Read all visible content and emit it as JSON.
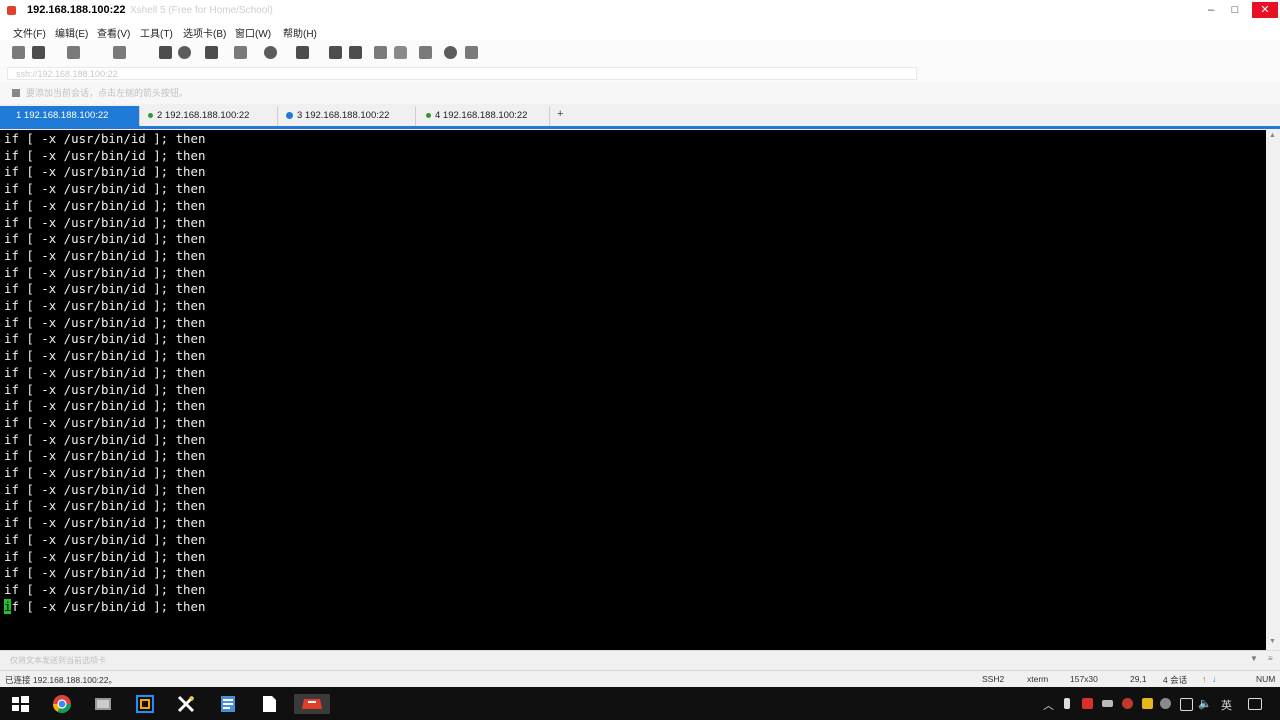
{
  "window": {
    "title": "192.168.188.100:22",
    "title_ghost": "Xshell 5 (Free for Home/School)"
  },
  "menu": [
    "文件(F)",
    "编辑(E)",
    "查看(V)",
    "工具(T)",
    "选项卡(B)",
    "窗口(W)",
    "帮助(H)"
  ],
  "toolbar": {
    "icons": [
      "new-session-icon",
      "open-folder-icon",
      "connect-icon",
      "reconnect-icon",
      "copy-icon",
      "find-icon",
      "print-icon",
      "transfer-icon",
      "globe-icon",
      "font-icon",
      "xftp-icon",
      "script-icon",
      "fullscreen-icon",
      "lock-icon",
      "keyboard-icon",
      "help-icon",
      "chat-icon"
    ]
  },
  "address": {
    "value": "ssh://192.168.188.100:22"
  },
  "sessions": {
    "label": "要添加当前会话，点击左侧的箭头按钮。"
  },
  "tabs": [
    {
      "label": "1 192.168.188.100:22",
      "active": true
    },
    {
      "label": "2 192.168.188.100:22",
      "active": false
    },
    {
      "label": "3 192.168.188.100:22",
      "active": false
    },
    {
      "label": "4 192.168.188.100:22",
      "active": false
    }
  ],
  "tab_add": "+",
  "terminal": {
    "cursor_char": "i",
    "lines": [
      "if [ -x /usr/bin/id ]; then",
      "if [ -x /usr/bin/id ]; then",
      "if [ -x /usr/bin/id ]; then",
      "if [ -x /usr/bin/id ]; then",
      "if [ -x /usr/bin/id ]; then",
      "if [ -x /usr/bin/id ]; then",
      "if [ -x /usr/bin/id ]; then",
      "if [ -x /usr/bin/id ]; then",
      "if [ -x /usr/bin/id ]; then",
      "if [ -x /usr/bin/id ]; then",
      "if [ -x /usr/bin/id ]; then",
      "if [ -x /usr/bin/id ]; then",
      "if [ -x /usr/bin/id ]; then",
      "if [ -x /usr/bin/id ]; then",
      "if [ -x /usr/bin/id ]; then",
      "if [ -x /usr/bin/id ]; then",
      "if [ -x /usr/bin/id ]; then",
      "if [ -x /usr/bin/id ]; then",
      "if [ -x /usr/bin/id ]; then",
      "if [ -x /usr/bin/id ]; then",
      "if [ -x /usr/bin/id ]; then",
      "if [ -x /usr/bin/id ]; then",
      "if [ -x /usr/bin/id ]; then",
      "if [ -x /usr/bin/id ]; then",
      "if [ -x /usr/bin/id ]; then",
      "if [ -x /usr/bin/id ]; then",
      "if [ -x /usr/bin/id ]; then",
      "if [ -x /usr/bin/id ]; then"
    ],
    "last_line_rest": "f [ -x /usr/bin/id ]; then"
  },
  "compose_hint": "仅将文本发送到当前选项卡",
  "status": {
    "connection": "已连接 192.168.188.100:22。",
    "protocol": "SSH2",
    "terminal_type": "xterm",
    "size": "157x30",
    "cursor_pos": "29,1",
    "sessions": "4 会话",
    "num": "NUM"
  },
  "taskbar": {
    "icons": [
      "windows-start-icon",
      "chrome-icon",
      "app-icon",
      "vmware-icon",
      "xmind-icon",
      "notes-icon",
      "file-icon",
      "xshell-icon"
    ],
    "tray_lang": "英"
  },
  "colors": {
    "accent": "#1e7ad6",
    "terminal_bg": "#000000",
    "terminal_fg": "#f0f0f0",
    "cursor": "#22c02a"
  }
}
